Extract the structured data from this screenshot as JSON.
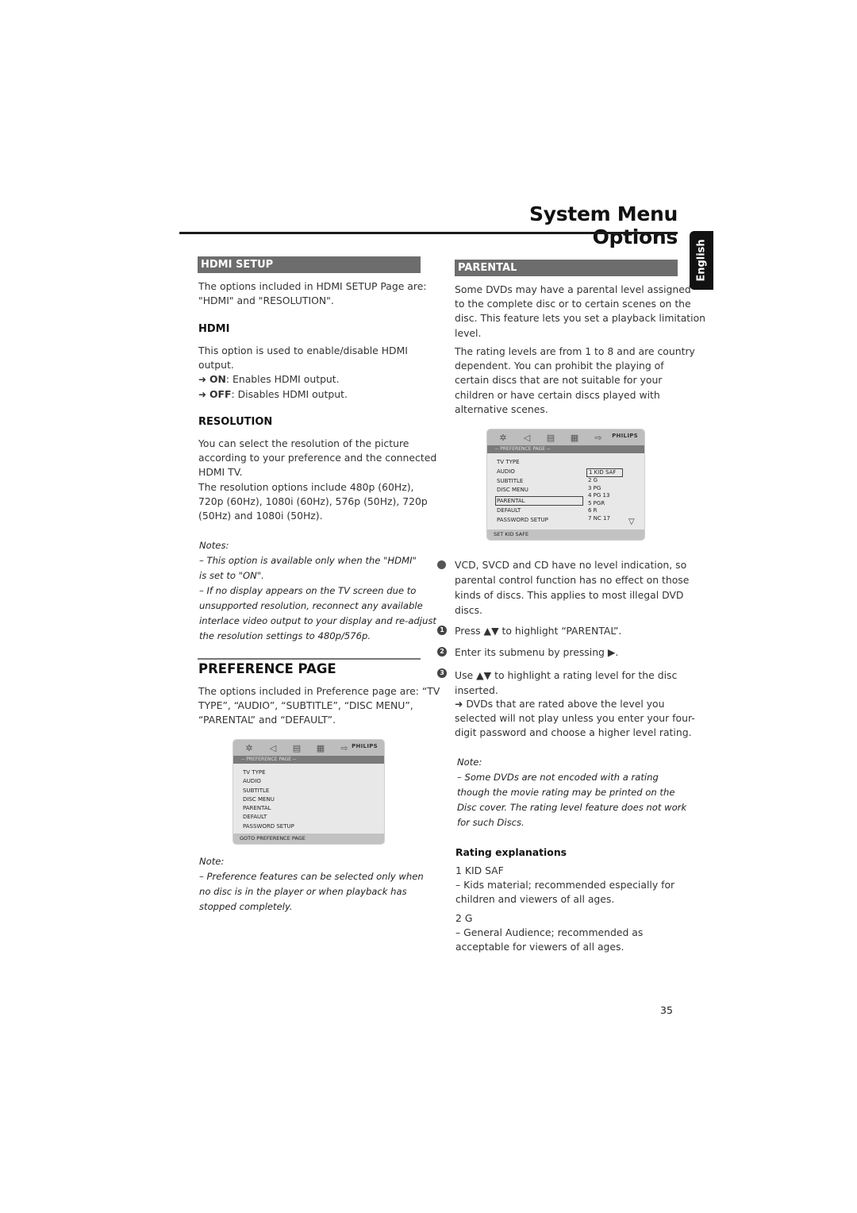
{
  "header": {
    "title": "System Menu Options",
    "language_tab": "English"
  },
  "left": {
    "hdmi_setup": {
      "bar": "HDMI SETUP",
      "intro": [
        "The options included in HDMI SETUP Page are:",
        "\"HDMI\" and \"RESOLUTION\"."
      ],
      "hdmi_heading": "HDMI",
      "hdmi_text": [
        "This option is used to enable/disable HDMI",
        "output."
      ],
      "options": [
        {
          "arrow": "➜",
          "key": "ON",
          "text": ": Enables HDMI output."
        },
        {
          "arrow": "➜",
          "key": "OFF",
          "text": ": Disables HDMI output."
        }
      ],
      "resolution_heading": "RESOLUTION",
      "resolution_text": [
        "You can select the resolution of the picture",
        "according to your preference and the connected",
        "HDMI TV.",
        "The resolution options include 480p (60Hz),",
        "720p (60Hz), 1080i (60Hz), 576p (50Hz), 720p",
        "(50Hz) and 1080i (50Hz)."
      ],
      "notes_label": "Notes:",
      "notes": [
        "–   This option is available only when the \"HDMI\"",
        "is set to \"ON\".",
        "–   If no display appears on the TV screen due to",
        "unsupported resolution, reconnect any available",
        "interlace video output to your display and re-adjust",
        "the resolution settings to 480p/576p."
      ]
    },
    "preference": {
      "heading": "PREFERENCE PAGE",
      "intro": [
        "The options included in Preference page are: “TV",
        "TYPE”, “AUDIO”, “SUBTITLE”, “DISC MENU”,",
        "“PARENTAL” and “DEFAULT”."
      ],
      "menu": {
        "icons": [
          "gear-icon",
          "speaker-icon",
          "subtitle-icon",
          "grid-icon",
          "exit-icon"
        ],
        "brand": "PHILIPS",
        "page_label": "-- PREFERENCE PAGE --",
        "items": [
          "TV TYPE",
          "AUDIO",
          "SUBTITLE",
          "DISC MENU",
          "PARENTAL",
          "DEFAULT",
          "PASSWORD SETUP"
        ],
        "footer": "GOTO PREFERENCE PAGE"
      },
      "note_label": "Note:",
      "note": [
        "–   Preference features can be selected only when",
        "no disc is in the player or when playback has",
        "stopped completely."
      ]
    }
  },
  "right": {
    "parental": {
      "bar": "PARENTAL",
      "p1": [
        "Some DVDs may have a parental level assigned",
        "to the complete disc or to certain scenes on the",
        "disc. This feature lets you set a playback limitation",
        "level."
      ],
      "p2": [
        "The rating levels are from 1 to 8 and are country",
        "dependent. You can prohibit the playing of",
        "certain discs that are not suitable for your",
        "children or have certain discs played with",
        "alternative scenes."
      ],
      "menu": {
        "brand": "PHILIPS",
        "page_label": "-- PREFERENCE PAGE --",
        "items": [
          "TV TYPE",
          "AUDIO",
          "SUBTITLE",
          "DISC MENU",
          "PARENTAL",
          "DEFAULT",
          "PASSWORD SETUP"
        ],
        "selected_item": "PARENTAL",
        "ratings": [
          "1 KID SAF",
          "2 G",
          "3 PG",
          "4 PG 13",
          "5 PGR",
          "6 R",
          "7 NC 17"
        ],
        "selected_rating": "1 KID SAF",
        "footer": "SET KID SAFE"
      },
      "bullet_text": [
        "VCD, SVCD and CD have no level indication, so",
        "parental control function has no effect on those",
        "kinds of discs. This applies to most illegal DVD",
        "discs."
      ],
      "steps": [
        {
          "num": "1",
          "text": "Press ▲▼  to highlight “PARENTAL”."
        },
        {
          "num": "2",
          "text": "Enter its submenu by pressing ▶."
        },
        {
          "num": "3",
          "text": "Use ▲▼  to highlight a rating level for the disc",
          "text2": "inserted."
        }
      ],
      "result": [
        "➜ DVDs that are rated above the level you",
        "selected will not play unless you enter your four-",
        "digit password and choose a higher level rating."
      ],
      "note_label": "Note:",
      "note": [
        "–   Some DVDs are not encoded with a rating",
        "though the movie rating may be printed on the",
        "Disc cover. The rating level feature does not work",
        "for such Discs."
      ],
      "ratings_heading": "Rating explanations",
      "rating_explanations": [
        {
          "name": "1 KID SAF",
          "desc": [
            "–   Kids material; recommended especially for",
            "children and viewers of all ages."
          ]
        },
        {
          "name": "2 G",
          "desc": [
            "–   General Audience; recommended as",
            "acceptable for viewers of all ages."
          ]
        }
      ]
    }
  },
  "footer": {
    "page_number": "35"
  }
}
